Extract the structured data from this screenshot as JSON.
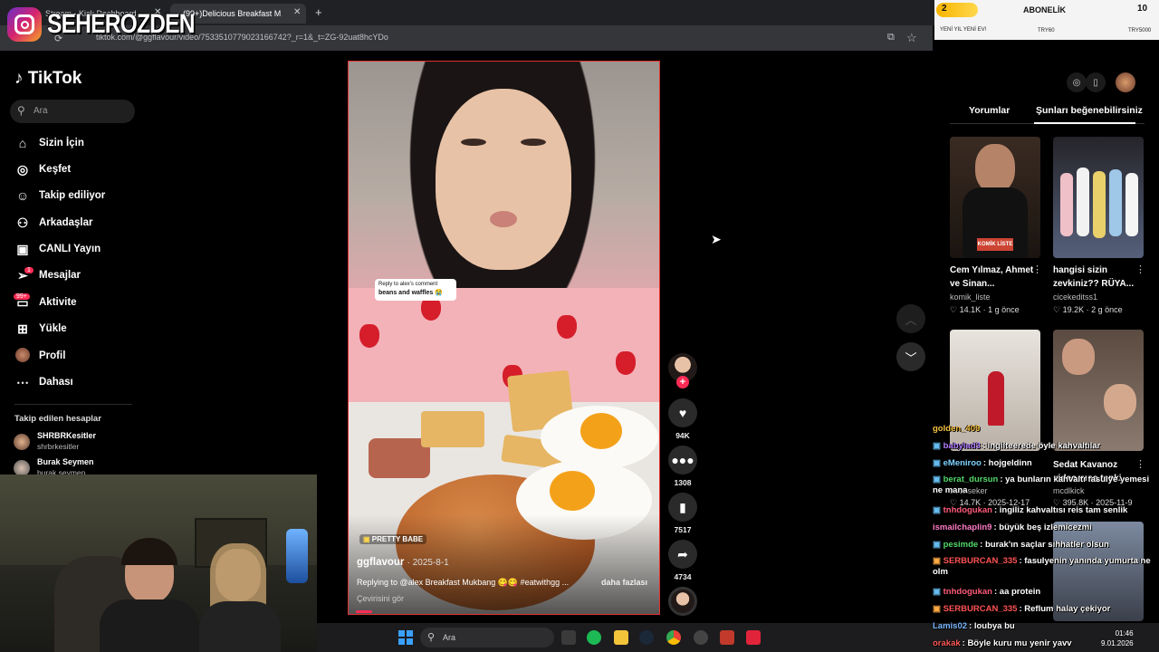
{
  "browser": {
    "tabs": [
      {
        "label": "Stream - Kick Dashboard"
      },
      {
        "label": "(99+)Delicious Breakfast M"
      }
    ],
    "tab_close": "✕",
    "new_tab": "+",
    "url": "tiktok.com/@ggflavour/video/7533510779023166742?_r=1&_t=ZG-92uat8hcYDo"
  },
  "donation": {
    "count": "2",
    "title": "ABONELİK",
    "right": "10",
    "subtitle": "YENİ YIL YENİ EV!",
    "mid": "TRY60",
    "amount": "TRY5000"
  },
  "streamer": {
    "name": "SEHEROZDEN"
  },
  "tiktok": {
    "logo": "TikTok",
    "search_placeholder": "Ara",
    "nav": [
      {
        "label": "Sizin İçin",
        "icon": "home-icon"
      },
      {
        "label": "Keşfet",
        "icon": "compass-icon"
      },
      {
        "label": "Takip ediliyor",
        "icon": "user-follow-icon"
      },
      {
        "label": "Arkadaşlar",
        "icon": "friends-icon"
      },
      {
        "label": "CANLI Yayın",
        "icon": "live-icon"
      },
      {
        "label": "Mesajlar",
        "icon": "send-icon",
        "badge": "1"
      },
      {
        "label": "Aktivite",
        "icon": "inbox-icon",
        "badge": "99+"
      },
      {
        "label": "Yükle",
        "icon": "upload-icon"
      },
      {
        "label": "Profil",
        "icon": "profile-avatar"
      },
      {
        "label": "Dahası",
        "icon": "more-icon"
      }
    ],
    "following_title": "Takip edilen hesaplar",
    "following": [
      {
        "name": "SHRBRKesitler",
        "handle": "shrbrkesitler"
      },
      {
        "name": "Burak Seymen",
        "handle": "burak.seymen"
      }
    ]
  },
  "video": {
    "comment_sticker_top": "Reply to alex's comment",
    "comment_sticker_text": "beans and waffles 😭",
    "tag": "PRETTY BABE",
    "author": "ggflavour",
    "date": "· 2025-8-1",
    "caption": "Replying to @alex Breakfast Mukbang 😋😋 #eatwithgg ...",
    "more": "daha fazlası",
    "translate": "Çevirisini gör"
  },
  "actions": {
    "likes": "94K",
    "comments": "1308",
    "saves": "7517",
    "shares": "4734"
  },
  "right_panel": {
    "tabs": [
      "Yorumlar",
      "Şunları beğenebilirsiniz"
    ],
    "cards": [
      {
        "title": "Cem Yılmaz, Ahmet ve Sinan...",
        "author": "komik_liste",
        "likes": "14.1K",
        "age": "1 g önce",
        "overlay": "KOMİK LİSTE"
      },
      {
        "title": "hangisi sizin zevkiniz?? RÜYA...",
        "author": "cicekeditss1",
        "likes": "19.2K",
        "age": "2 g önce"
      },
      {
        "title": "",
        "author": "eser.seker",
        "likes": "14.7K",
        "age": "2025-12-17"
      },
      {
        "title": "Sedat Kavanoz videosuna tepki",
        "author": "mcdlkick",
        "likes": "395.8K",
        "age": "2025-11-9"
      }
    ]
  },
  "chat": [
    {
      "user": "golden_409",
      "msg": "",
      "color": "#f5c242"
    },
    {
      "user": "babylad3",
      "msg": ": ingilteerede öyle kahvaltılar",
      "color": "#b07cff"
    },
    {
      "user": "eMeniroo",
      "msg": ": hojgeldinn",
      "color": "#7cd3ff"
    },
    {
      "user": "berat_dursun",
      "msg": ": ya bunların kahvaltı fasulye yemesi ne mana",
      "color": "#53d86a"
    },
    {
      "user": "tnhdogukan",
      "msg": ": ingiliz kahvaltısı reis tam senlik",
      "color": "#ff5b7a"
    },
    {
      "user": "ismailchaplin9",
      "msg": ": büyük beş izlemicezmi",
      "color": "#ff7bc5"
    },
    {
      "user": "pesimde",
      "msg": ": burak'ın saçlar sıhhatler olsun",
      "color": "#53d86a"
    },
    {
      "user": "SERBURCAN_335",
      "msg": ": fasulyenin yanında yumurta ne olm",
      "color": "#ff5252"
    },
    {
      "user": "tnhdogukan",
      "msg": ": aa protein",
      "color": "#ff5b7a"
    },
    {
      "user": "SERBURCAN_335",
      "msg": ": Reflum halay çekiyor",
      "color": "#ff5252"
    },
    {
      "user": "Lamis02",
      "msg": ": loubya bu",
      "color": "#7cb8ff"
    },
    {
      "user": "orakak",
      "msg": ": Böyle kuru mu yenir yavv",
      "color": "#ff5b5b"
    }
  ],
  "taskbar": {
    "search": "Ara",
    "time": "01:46",
    "date": "9.01.2026"
  }
}
